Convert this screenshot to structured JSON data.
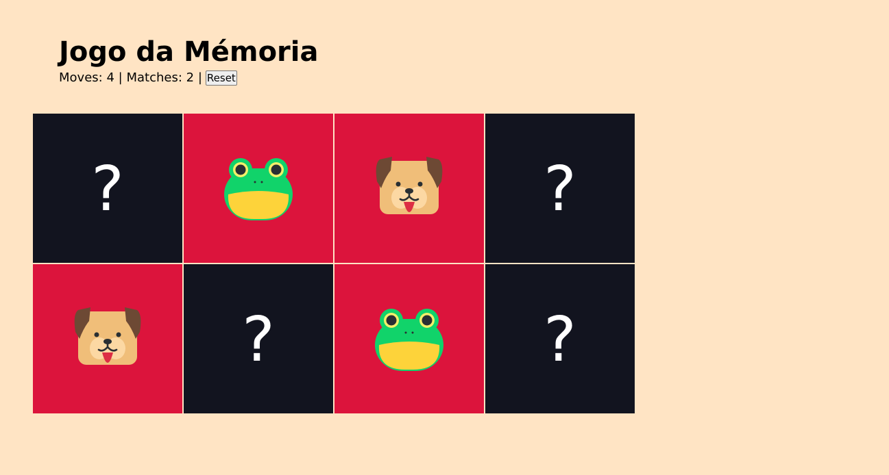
{
  "game": {
    "title": "Jogo da Mémoria",
    "moves_label": "Moves:",
    "moves": "4",
    "separator": "|",
    "matches_label": "Matches:",
    "matches": "2",
    "reset_label": "Reset"
  },
  "colors": {
    "background": "#ffe4c4",
    "card_hidden": "#12141f",
    "card_revealed": "#dc143c"
  },
  "board": {
    "hidden_symbol": "?",
    "cards": [
      {
        "state": "hidden",
        "face": "?"
      },
      {
        "state": "revealed",
        "face": "frog-icon"
      },
      {
        "state": "revealed",
        "face": "dog-icon"
      },
      {
        "state": "hidden",
        "face": "?"
      },
      {
        "state": "revealed",
        "face": "dog-icon"
      },
      {
        "state": "hidden",
        "face": "?"
      },
      {
        "state": "revealed",
        "face": "frog-icon"
      },
      {
        "state": "hidden",
        "face": "?"
      }
    ]
  }
}
